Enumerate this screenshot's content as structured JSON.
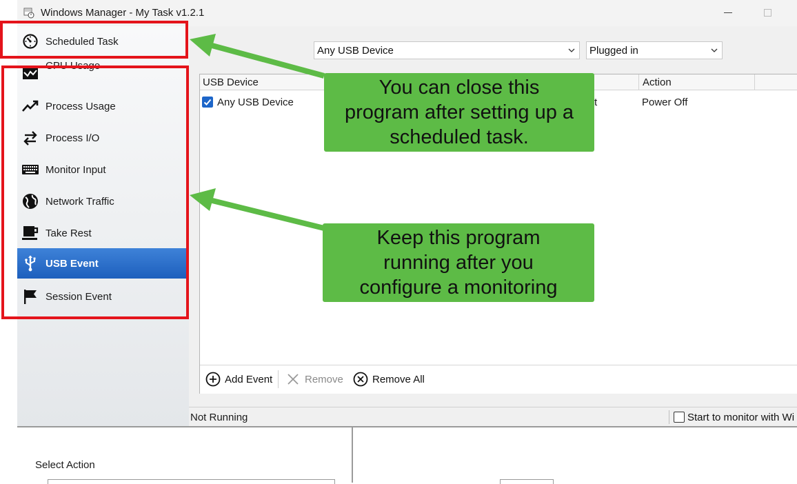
{
  "window": {
    "title": "Windows Manager - My Task v1.2.1"
  },
  "sidebar": {
    "items": [
      {
        "label": "Scheduled Task",
        "icon": "timer-icon"
      },
      {
        "label": "CPU Usage",
        "icon": "cpu-chart-icon"
      },
      {
        "label": "Process Usage",
        "icon": "trend-up-icon"
      },
      {
        "label": "Process I/O",
        "icon": "swap-arrows-icon"
      },
      {
        "label": "Monitor Input",
        "icon": "keyboard-icon"
      },
      {
        "label": "Network Traffic",
        "icon": "globe-icon"
      },
      {
        "label": "Take Rest",
        "icon": "coffee-cup-icon"
      },
      {
        "label": "USB Event",
        "icon": "usb-icon",
        "active": true
      },
      {
        "label": "Session Event",
        "icon": "flag-icon"
      }
    ]
  },
  "filters": {
    "device": {
      "value": "Any USB Device"
    },
    "state": {
      "value": "Plugged in"
    }
  },
  "grid": {
    "columns": [
      "USB Device",
      "Action"
    ],
    "rows": [
      {
        "checked": true,
        "device": "Any USB Device",
        "event_fragment": "t",
        "action": "Power Off"
      }
    ]
  },
  "toolbar": {
    "add": "Add Event",
    "remove": "Remove",
    "remove_all": "Remove All"
  },
  "status": {
    "text": "Not Running",
    "checkbox_label": "Start to monitor with Wi"
  },
  "lower": {
    "select_label": "Select Action"
  },
  "annotations": {
    "callout_top": [
      "You can close this",
      "program after setting up a",
      "scheduled task."
    ],
    "callout_bottom": [
      "Keep this program",
      "running after you",
      "configure a monitoring"
    ]
  },
  "colors": {
    "accent": "#1d5fbd",
    "highlight": "#e4141b",
    "callout": "#5dbb46"
  }
}
